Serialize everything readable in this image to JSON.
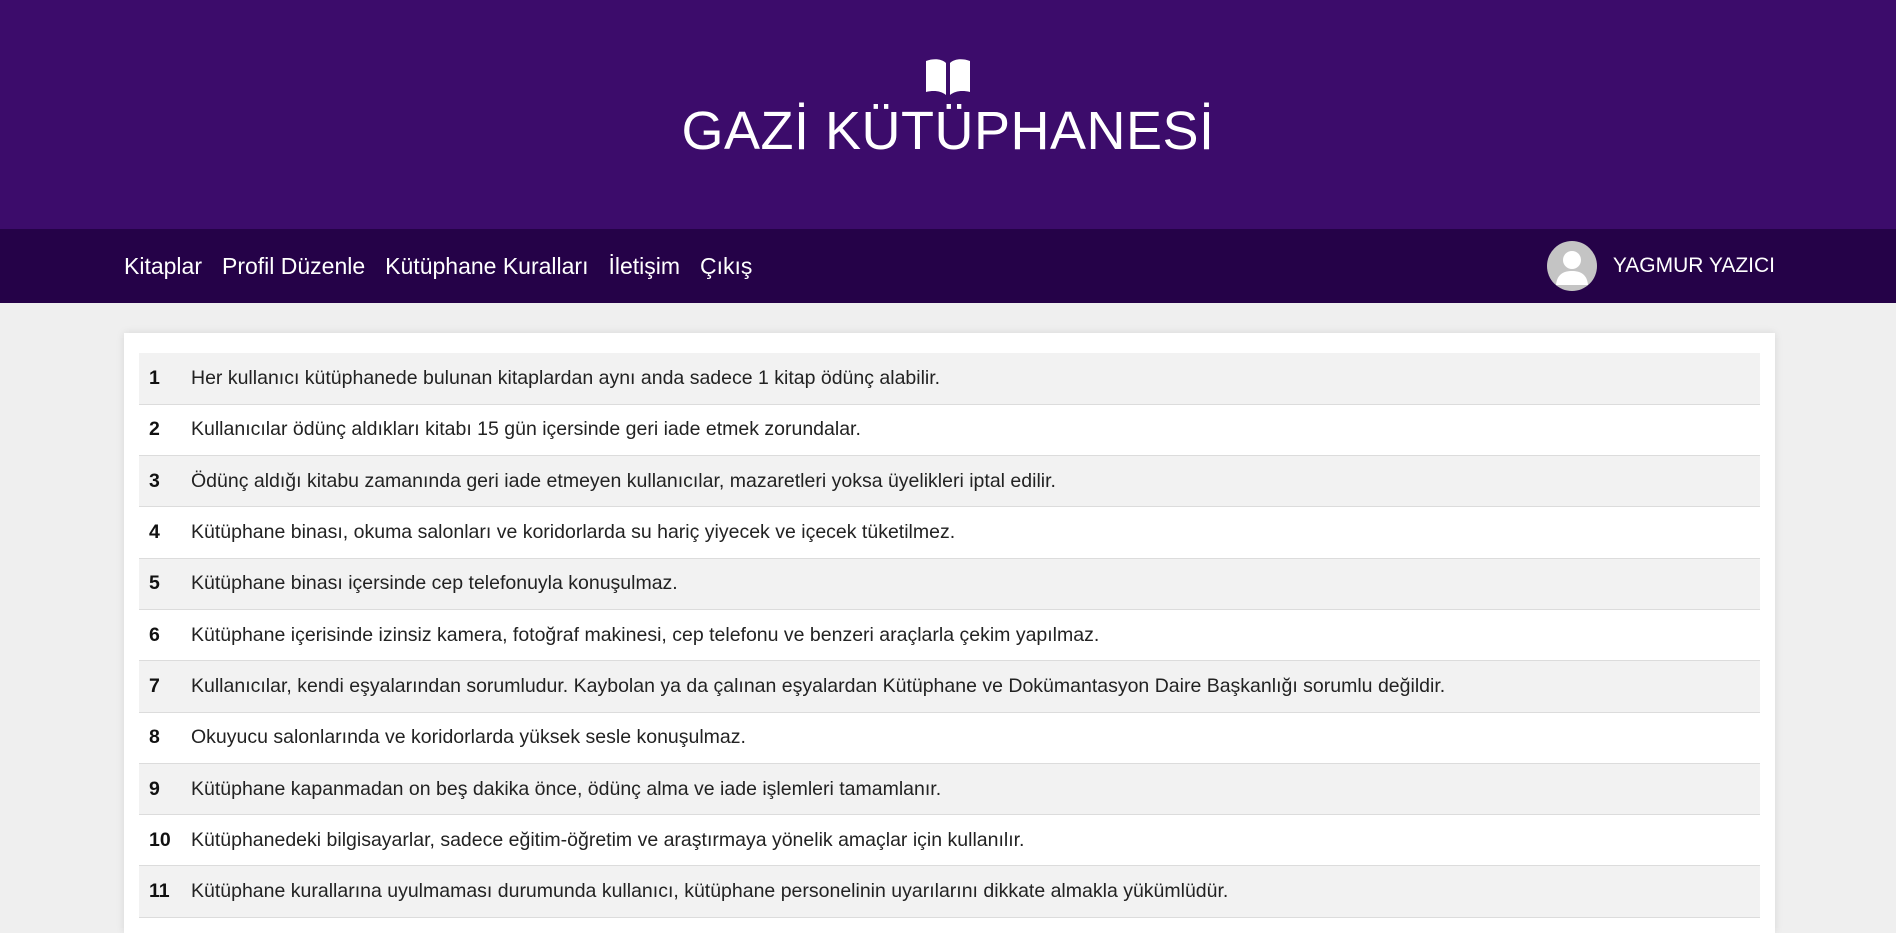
{
  "header": {
    "title": "GAZİ KÜTÜPHANESİ",
    "icon": "open-book-icon"
  },
  "nav": {
    "links": [
      "Kitaplar",
      "Profil Düzenle",
      "Kütüphane Kuralları",
      "İletişim",
      "Çıkış"
    ],
    "user_name": "YAGMUR YAZICI",
    "user_icon": "avatar-user-icon"
  },
  "rules": [
    {
      "num": "1",
      "text": "Her kullanıcı kütüphanede bulunan kitaplardan aynı anda sadece 1 kitap ödünç alabilir."
    },
    {
      "num": "2",
      "text": "Kullanıcılar ödünç aldıkları kitabı 15 gün içersinde geri iade etmek zorundalar."
    },
    {
      "num": "3",
      "text": "Ödünç aldığı kitabu zamanında geri iade etmeyen kullanıcılar, mazaretleri yoksa üyelikleri iptal edilir."
    },
    {
      "num": "4",
      "text": "Kütüphane binası, okuma salonları ve koridorlarda su hariç yiyecek ve içecek tüketilmez."
    },
    {
      "num": "5",
      "text": "Kütüphane binası içersinde cep telefonuyla konuşulmaz."
    },
    {
      "num": "6",
      "text": "Kütüphane içerisinde izinsiz kamera, fotoğraf makinesi, cep telefonu ve benzeri araçlarla çekim yapılmaz."
    },
    {
      "num": "7",
      "text": "Kullanıcılar, kendi eşyalarından sorumludur. Kaybolan ya da çalınan eşyalardan Kütüphane ve Dokümantasyon Daire Başkanlığı sorumlu değildir."
    },
    {
      "num": "8",
      "text": "Okuyucu salonlarında ve koridorlarda yüksek sesle konuşulmaz."
    },
    {
      "num": "9",
      "text": "Kütüphane kapanmadan on beş dakika önce, ödünç alma ve iade işlemleri tamamlanır."
    },
    {
      "num": "10",
      "text": "Kütüphanedeki bilgisayarlar, sadece eğitim-öğretim ve araştırmaya yönelik amaçlar için kullanılır."
    },
    {
      "num": "11",
      "text": "Kütüphane kurallarına uyulmaması durumunda kullanıcı, kütüphane personelinin uyarılarını dikkate almakla yükümlüdür."
    }
  ]
}
